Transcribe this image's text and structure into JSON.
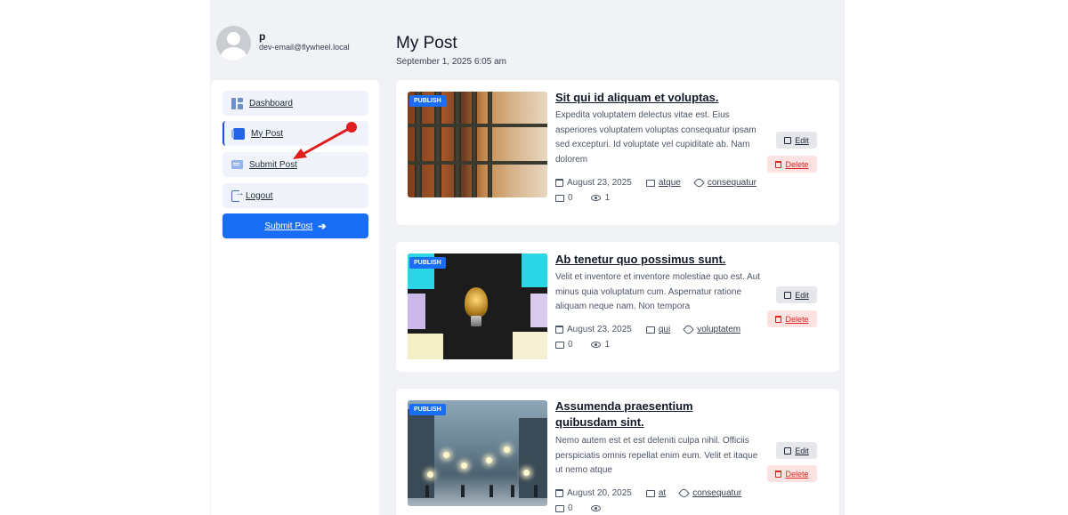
{
  "profile": {
    "name": "p",
    "email": "dev-email@flywheel.local"
  },
  "sidebar": {
    "items": [
      {
        "label": "Dashboard",
        "icon": "dashboard-icon"
      },
      {
        "label": "My Post",
        "icon": "post-icon"
      },
      {
        "label": "Submit Post",
        "icon": "submit-icon"
      },
      {
        "label": "Logout",
        "icon": "logout-icon"
      }
    ],
    "submit_button": "Submit Post"
  },
  "header": {
    "title": "My Post",
    "date": "September 1, 2025 6:05 am"
  },
  "posts": [
    {
      "status": "PUBLISH",
      "title": "Sit qui id aliquam et voluptas.",
      "excerpt": "Expedita voluptatem delectus vitae est. Eius asperiores voluptatem voluptas consequatur ipsam sed excepturi. Id voluptate vel cupiditate ab. Nam dolorem",
      "date": "August 23, 2025",
      "category": "atque",
      "tag": "consequatur",
      "comments": "0",
      "views": "1",
      "edit_label": "Edit",
      "delete_label": "Delete"
    },
    {
      "status": "PUBLISH",
      "title": "Ab tenetur quo possimus sunt.",
      "excerpt": "Velit et inventore et inventore molestiae quo est. Aut minus quia voluptatum cum. Aspernatur ratione aliquam neque nam. Non tempora",
      "date": "August 23, 2025",
      "category": "qui",
      "tag": "voluptatem",
      "comments": "0",
      "views": "1",
      "edit_label": "Edit",
      "delete_label": "Delete"
    },
    {
      "status": "PUBLISH",
      "title": "Assumenda praesentium quibusdam sint.",
      "excerpt": "Nemo autem est et est deleniti culpa nihil. Officiis perspiciatis omnis repellat enim eum. Velit et itaque ut nemo atque",
      "date": "August 20, 2025",
      "category": "at",
      "tag": "consequatur",
      "comments": "0",
      "views": "",
      "edit_label": "Edit",
      "delete_label": "Delete"
    }
  ],
  "colors": {
    "accent": "#1a6ef5",
    "danger": "#dc2626",
    "arrow": "#e11d1d"
  }
}
